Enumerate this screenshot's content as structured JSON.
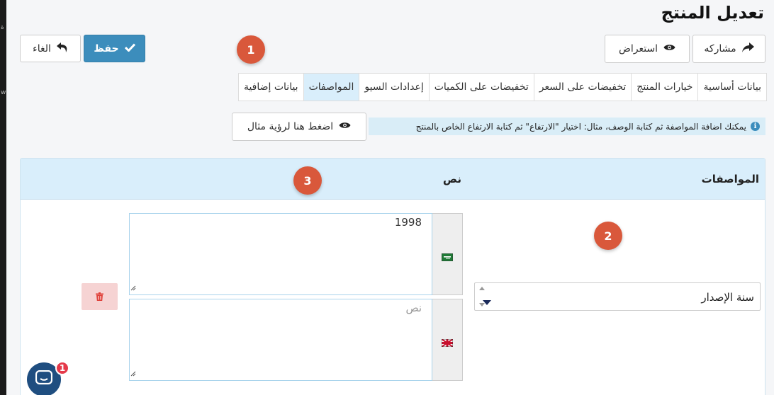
{
  "page": {
    "title": "تعديل المنتج"
  },
  "left_strip": {
    "frag_top": "ة",
    "frag_mid": "w"
  },
  "toolbar": {
    "share_label": "مشاركه",
    "preview_label": "استعراض",
    "save_label": "حفظ",
    "cancel_label": "الغاء"
  },
  "badges": {
    "b1": "1",
    "b2": "2",
    "b3": "3"
  },
  "tabs": [
    {
      "label": "بيانات أساسية"
    },
    {
      "label": "خيارات المنتج"
    },
    {
      "label": "تخفيضات على السعر"
    },
    {
      "label": "تخفيضات على الكميات"
    },
    {
      "label": "إعدادات السيو"
    },
    {
      "label": "المواصفات",
      "active": true
    },
    {
      "label": "بيانات إضافية"
    }
  ],
  "info": {
    "text": "يمكنك اضافة المواصفة ثم كتابة الوصف، مثال: اختيار \"الارتفاع\" ثم كتابة الارتفاع الخاص بالمنتج",
    "example_button": "اضغط هنا لرؤية مثال"
  },
  "specs_table": {
    "col_specs": "المواصفات",
    "col_text": "نص",
    "row": {
      "select_value": "سنة الإصدار",
      "value_ar": "1998",
      "placeholder_en": "نص"
    }
  },
  "chat": {
    "unread_count": "1"
  },
  "colors": {
    "primary": "#3c8dbc",
    "badge": "#d9583b",
    "active_tab": "#d9eefb",
    "delete_bg": "#f6d3d3"
  }
}
